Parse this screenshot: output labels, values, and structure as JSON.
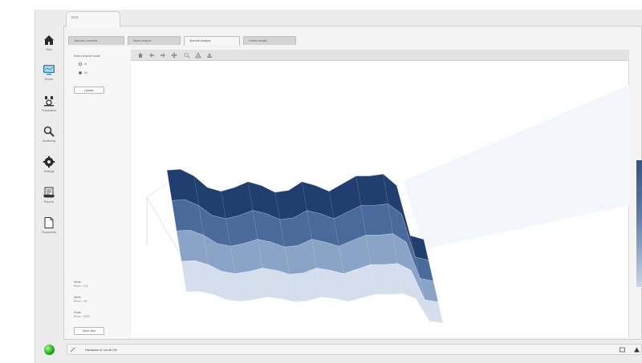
{
  "app": {
    "document_tab": "ECG"
  },
  "nav": [
    {
      "label": "Start",
      "icon": "home-icon"
    },
    {
      "label": "Device",
      "icon": "monitor-icon"
    },
    {
      "label": "Preparation",
      "icon": "electrodes-icon"
    },
    {
      "label": "Monitoring",
      "icon": "magnifier-icon"
    },
    {
      "label": "Settings",
      "icon": "gear-icon"
    },
    {
      "label": "Reports",
      "icon": "reports-icon"
    },
    {
      "label": "Documents",
      "icon": "document-icon"
    }
  ],
  "subtabs": [
    {
      "label": "Standard channels",
      "active": false
    },
    {
      "label": "Wave analysis",
      "active": false
    },
    {
      "label": "Spectral analysis",
      "active": true
    },
    {
      "label": "Further details",
      "active": false
    }
  ],
  "options": {
    "title": "Select channel mode",
    "radios": [
      {
        "label": "I/I",
        "checked": false
      },
      {
        "label": "I/II",
        "checked": true
      }
    ],
    "apply_button": "Update",
    "stats": [
      {
        "label": "Mean",
        "value": "Rcorr = 0.6"
      },
      {
        "label": "Mean",
        "value": "Rcorr = 45"
      },
      {
        "label": "Scale",
        "value": "Rcorr = 4000"
      }
    ],
    "export_button": "Save view"
  },
  "toolbar": {
    "tools": [
      "home-icon",
      "back-arrow-icon",
      "forward-arrow-icon",
      "pan-icon",
      "zoom-icon",
      "configure-icon",
      "save-icon"
    ]
  },
  "chart_data": {
    "type": "surface3d",
    "colormap": "Blues",
    "colormap_colors": [
      "#213f6e",
      "#4a6a9b",
      "#8aa4c8",
      "#d4deed",
      "#f4f7fb"
    ],
    "z_profile": [
      0.78,
      0.79,
      0.72,
      0.6,
      0.56,
      0.6,
      0.66,
      0.62,
      0.55,
      0.57,
      0.66,
      0.62,
      0.56,
      0.64,
      0.72,
      0.72,
      0.74,
      0.62,
      0.1,
      0.06
    ]
  },
  "status": {
    "text": "Hardware is not all OK",
    "led_color": "#21b11d"
  }
}
